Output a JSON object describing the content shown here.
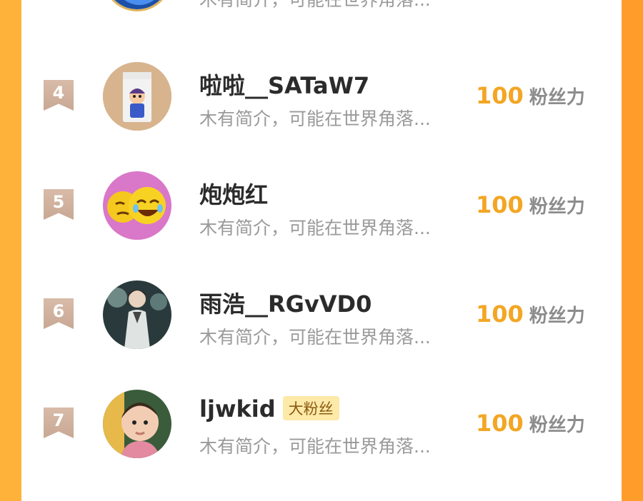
{
  "ranking": {
    "partial_top": {
      "description": "木有简介，可能在世界角落..."
    },
    "entries": [
      {
        "rank": "4",
        "name": "啦啦__SATaW7",
        "badge": "",
        "description": "木有简介，可能在世界角落...",
        "score_value": "100",
        "score_unit": "粉丝力"
      },
      {
        "rank": "5",
        "name": "炮炮红",
        "badge": "",
        "description": "木有简介，可能在世界角落...",
        "score_value": "100",
        "score_unit": "粉丝力"
      },
      {
        "rank": "6",
        "name": "雨浩__RGvVD0",
        "badge": "",
        "description": "木有简介，可能在世界角落...",
        "score_value": "100",
        "score_unit": "粉丝力"
      },
      {
        "rank": "7",
        "name": "ljwkid",
        "badge": "大粉丝",
        "description": "木有简介，可能在世界角落...",
        "score_value": "100",
        "score_unit": "粉丝力"
      }
    ]
  },
  "colors": {
    "background_orange": "#ffab36",
    "score_orange": "#f3a624",
    "rank_badge": "#cfb19d",
    "badge_yellow": "#fde9a8"
  }
}
